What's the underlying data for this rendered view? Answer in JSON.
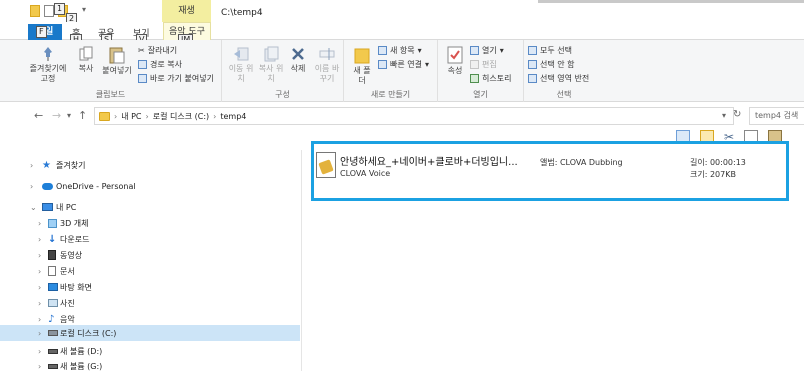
{
  "window": {
    "title": "C:\\temp4",
    "contextual_tab_group": "재생"
  },
  "quick_access": {
    "keytips": [
      "1",
      "2"
    ]
  },
  "tabs": {
    "file": {
      "label": "파일",
      "keytip": "F"
    },
    "items": [
      {
        "label": "홈",
        "keytip": "H"
      },
      {
        "label": "공유",
        "keytip": "S"
      },
      {
        "label": "보기",
        "keytip": "V"
      },
      {
        "label": "음악 도구",
        "keytip": "JM"
      }
    ]
  },
  "ribbon": {
    "clipboard": {
      "label": "클립보드",
      "pin": "즐겨찾기에 고정",
      "copy": "복사",
      "paste": "붙여넣기",
      "cut": "잘라내기",
      "copy_path": "경로 복사",
      "paste_shortcut": "바로 가기 붙여넣기"
    },
    "organize": {
      "label": "구성",
      "move_to": "이동 위치",
      "copy_to": "복사 위치",
      "delete": "삭제",
      "rename": "이름 바꾸기"
    },
    "new": {
      "label": "새로 만들기",
      "new_folder": "새 폴더",
      "new_item": "새 항목",
      "easy_access": "빠른 연결"
    },
    "open": {
      "label": "열기",
      "properties": "속성",
      "open": "열기",
      "edit": "편집",
      "history": "히스토리"
    },
    "select": {
      "label": "선택",
      "select_all": "모두 선택",
      "select_none": "선택 안 함",
      "invert": "선택 영역 반전"
    }
  },
  "address": {
    "segments": [
      "내 PC",
      "로컬 디스크 (C:)",
      "temp4"
    ],
    "search_placeholder": "temp4 검색"
  },
  "nav": {
    "items": [
      {
        "label": "즐겨찾기",
        "level": 0
      },
      {
        "label": "OneDrive - Personal",
        "level": 0
      },
      {
        "label": "내 PC",
        "level": 0
      },
      {
        "label": "3D 개체",
        "level": 1
      },
      {
        "label": "다운로드",
        "level": 1
      },
      {
        "label": "동영상",
        "level": 1
      },
      {
        "label": "문서",
        "level": 1
      },
      {
        "label": "바탕 화면",
        "level": 1
      },
      {
        "label": "사진",
        "level": 1
      },
      {
        "label": "음악",
        "level": 1
      },
      {
        "label": "로컬 디스크 (C:)",
        "level": 1,
        "selected": true
      },
      {
        "label": "새 볼륨 (D:)",
        "level": 1
      },
      {
        "label": "새 볼륨 (G:)",
        "level": 1
      }
    ]
  },
  "file": {
    "name": "안녕하세요_+네이버+클로바+더빙입니...",
    "artist": "CLOVA Voice",
    "album": "앨범: CLOVA Dubbing",
    "length": "길이: 00:00:13",
    "size": "크기: 207KB"
  },
  "colors": {
    "highlight_border": "#1ba1e2",
    "file_tab": "#1979ca",
    "selected_nav": "#cce4f7"
  }
}
